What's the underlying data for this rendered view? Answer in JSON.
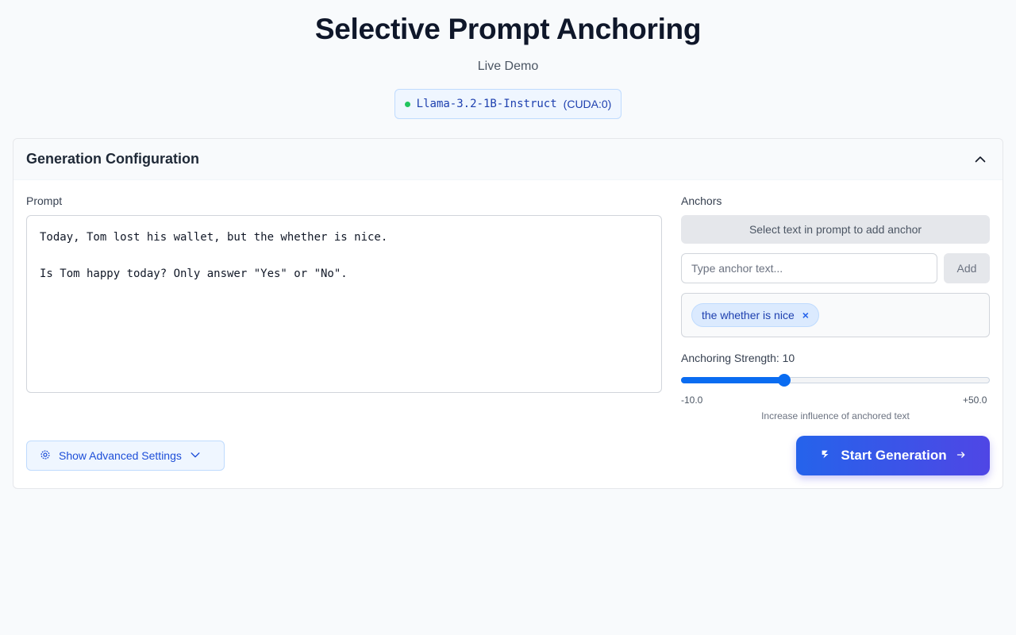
{
  "header": {
    "title": "Selective Prompt Anchoring",
    "subtitle": "Live Demo",
    "model_name": "Llama-3.2-1B-Instruct",
    "model_device": "(CUDA:0)",
    "status_color": "#22c55e"
  },
  "panel": {
    "title": "Generation Configuration"
  },
  "prompt": {
    "label": "Prompt",
    "value": "Today, Tom lost his wallet, but the whether is nice.\n\nIs Tom happy today? Only answer \"Yes\" or \"No\"."
  },
  "anchors": {
    "label": "Anchors",
    "select_button": "Select text in prompt to add anchor",
    "input_placeholder": "Type anchor text...",
    "input_value": "",
    "add_button": "Add",
    "items": [
      {
        "text": "the whether is nice",
        "remove": "×"
      }
    ]
  },
  "strength": {
    "label": "Anchoring Strength: 10",
    "value": 10,
    "min": -10,
    "max": 50,
    "min_label": "-10.0",
    "max_label": "+50.0",
    "hint": "Increase influence of anchored text"
  },
  "actions": {
    "advanced_label": "Show Advanced Settings",
    "start_label": "Start Generation",
    "accent": "#2563eb"
  }
}
